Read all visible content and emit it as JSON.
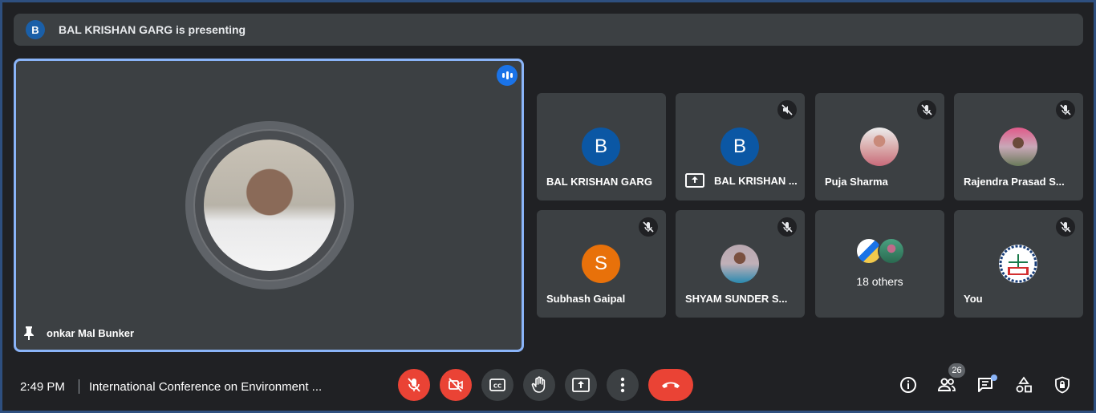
{
  "banner": {
    "avatar_letter": "B",
    "text": "BAL KRISHAN GARG is presenting"
  },
  "main_tile": {
    "name": "onkar Mal Bunker",
    "speaking": true
  },
  "tiles": [
    {
      "name": "BAL KRISHAN GARG",
      "avatar_letter": "B",
      "avatar_color": "#0b57a4",
      "muted": false,
      "presenting": false
    },
    {
      "name": "BAL KRISHAN ...",
      "avatar_letter": "B",
      "avatar_color": "#0b57a4",
      "muted": true,
      "presenting": true
    },
    {
      "name": "Puja Sharma",
      "avatar_letter": "",
      "muted": true
    },
    {
      "name": "Rajendra Prasad S...",
      "avatar_letter": "",
      "muted": true
    },
    {
      "name": "Subhash Gaipal",
      "avatar_letter": "S",
      "avatar_color": "#e8710a",
      "muted": true
    },
    {
      "name": "SHYAM SUNDER S...",
      "avatar_letter": "",
      "muted": true
    },
    {
      "name": "18 others"
    },
    {
      "name": "You",
      "muted": true
    }
  ],
  "bottom_bar": {
    "time": "2:49 PM",
    "meeting_title": "International Conference on Environment ...",
    "participant_count": "26"
  },
  "colors": {
    "background": "#202124",
    "tile": "#3c4043",
    "accent_blue": "#8ab4f8",
    "danger_red": "#ea4335"
  }
}
